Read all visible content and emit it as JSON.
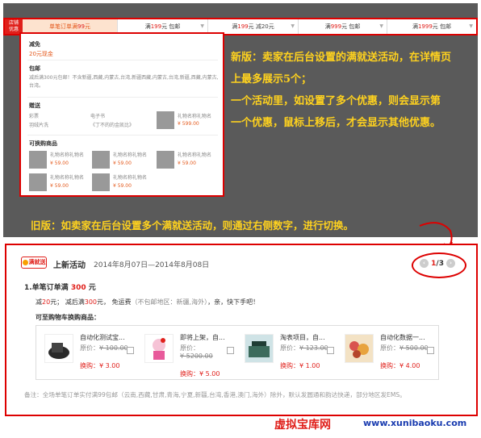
{
  "new_version": {
    "badge": "店铺\n优惠",
    "tabs": [
      {
        "pre": "单笔订单满",
        "num": "99",
        "post": "元",
        "chev": "▼"
      },
      {
        "pre": "满",
        "num": "199",
        "post": "元 包邮",
        "chev": "▼"
      },
      {
        "pre": "满",
        "num": "199",
        "post": "元 减20元",
        "chev": "▼"
      },
      {
        "pre": "满",
        "num": "999",
        "post": "元 包邮",
        "chev": "▼"
      },
      {
        "pre": "满",
        "num": "1999",
        "post": "元 包邮",
        "chev": "▼"
      }
    ],
    "panel": {
      "discount_title": "减免",
      "discount_value": "20元现金",
      "shipping_title": "包邮",
      "shipping_desc": "减后满300元包邮！不含新疆,西藏,内蒙古,台湾,新疆西藏,内蒙古,台湾,新疆,西藏,内蒙古,台湾。",
      "gift_title": "赠送",
      "gift_col1": [
        "彩票",
        "羽绒片洗"
      ],
      "gift_col2": [
        "电子书",
        "《丁不的的金凯比》"
      ],
      "gift_name": "礼物名称礼物名",
      "gift_price": "¥ 599.00",
      "exchange_title": "可换购商品",
      "exchange_items": [
        {
          "name": "礼物名称礼物名",
          "price": "¥ 59.00"
        },
        {
          "name": "礼物名称礼物名",
          "price": "¥ 59.00"
        },
        {
          "name": "礼物名称礼物名",
          "price": "¥ 59.00"
        },
        {
          "name": "礼物名称礼物名",
          "price": "¥ 59.00"
        },
        {
          "name": "礼物名称礼物名",
          "price": "¥ 59.00"
        }
      ]
    },
    "note_lines": [
      "新版：卖家在后台设置的满就送活动，在详情页",
      "上最多展示5个；",
      "一个活动里，如设置了多个优惠，则会显示第",
      "一个优惠，鼠标上移后，才会显示其他优惠。"
    ]
  },
  "old_version": {
    "note": "旧版：如卖家在后台设置多个满就送活动，则通过右侧数字，进行切换。",
    "tag": "满就送",
    "title": "上新活动",
    "date": "2014年8月07日—2014年8月08日",
    "pager": {
      "current": "1",
      "total": "/3",
      "prev": "‹",
      "next": "›"
    },
    "line1_pre": "1.单笔订单满 ",
    "line1_num": "300",
    "line1_post": " 元",
    "line2": {
      "a": "减",
      "b": "20",
      "c": "元；  减后满",
      "d": "300",
      "e": "元， 免运费",
      "f": "（不包邮地区：新疆,海外）",
      "g": "，亲，快下手吧！"
    },
    "line3": "可至购物车换购商品：",
    "goods": [
      {
        "name": "自动化测试宝...",
        "orig_label": "原价：",
        "orig": "¥ 100.00",
        "buy_label": "换购：",
        "buy": "¥ 3.00"
      },
      {
        "name": "即将上架，自...",
        "orig_label": "原价：",
        "orig": "¥ 5200.00",
        "buy_label": "换购：",
        "buy": "¥ 5.00"
      },
      {
        "name": "淘表项目，自...",
        "orig_label": "原价：",
        "orig": "¥ 123.00",
        "buy_label": "换购：",
        "buy": "¥ 1.00"
      },
      {
        "name": "自动化数据一...",
        "orig_label": "原价：",
        "orig": "¥ 500.00",
        "buy_label": "换购：",
        "buy": "¥ 4.00"
      }
    ],
    "footnote": "备注：全场单笔订单实付满99包邮（云南,西藏,甘肃,青海,宁夏,新疆,台湾,香港,澳门,海外）除外，默认发圆通和韵达快递，部分地区发EMS。"
  },
  "watermark": {
    "name": "虚拟宝库网",
    "url": "www.xunibaoku.com"
  }
}
